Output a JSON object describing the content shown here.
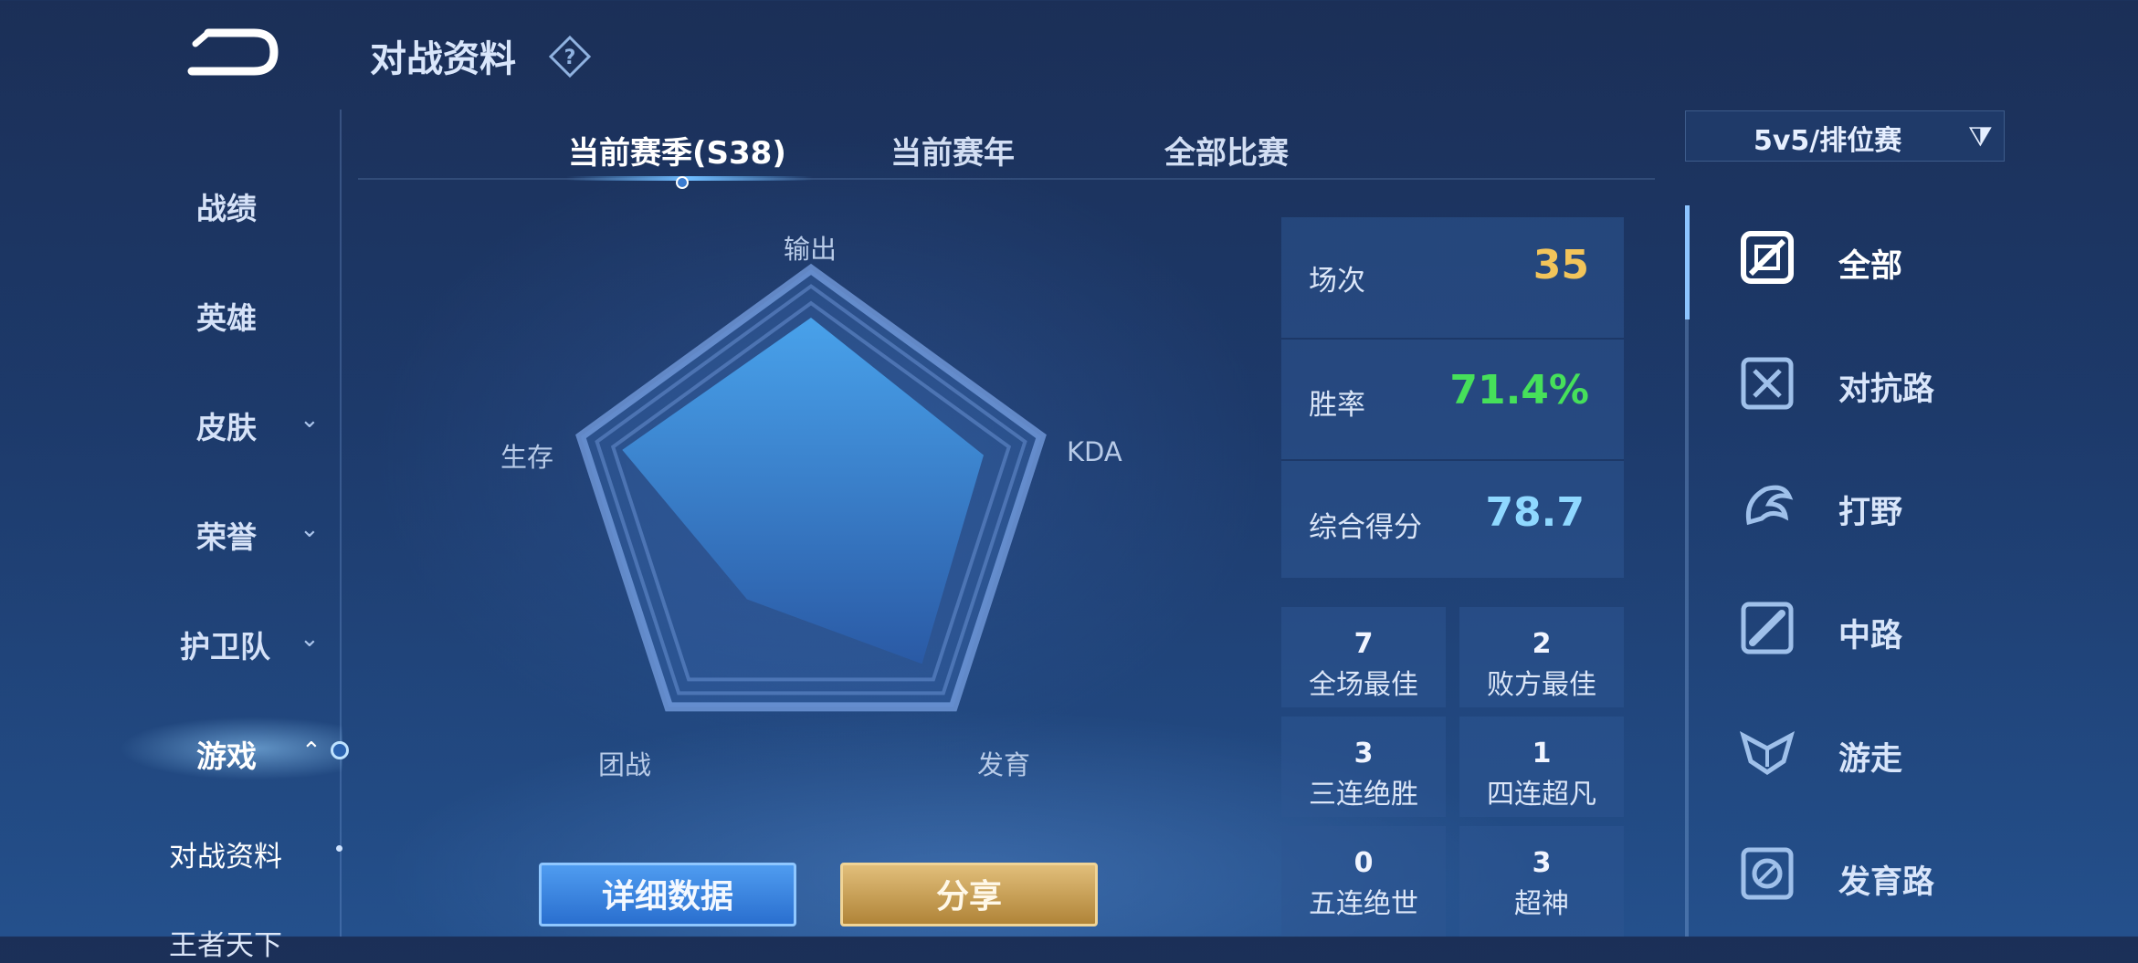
{
  "header": {
    "title": "对战资料",
    "back_icon": "back-arrow-icon",
    "help_icon": "question-diamond-icon"
  },
  "sidebar": {
    "items": [
      {
        "label": "战绩",
        "expandable": false
      },
      {
        "label": "英雄",
        "expandable": false
      },
      {
        "label": "皮肤",
        "expandable": true
      },
      {
        "label": "荣誉",
        "expandable": true
      },
      {
        "label": "护卫队",
        "expandable": true
      },
      {
        "label": "游戏",
        "expandable": true,
        "active": true
      }
    ],
    "subitems": [
      {
        "label": "对战资料",
        "active": true
      },
      {
        "label": "王者天下"
      }
    ]
  },
  "tabs": [
    {
      "label": "当前赛季(S38)",
      "active": true
    },
    {
      "label": "当前赛年"
    },
    {
      "label": "全部比赛"
    }
  ],
  "filter": {
    "label": "5v5/排位赛",
    "icon": "filter-icon"
  },
  "radar": {
    "axes": [
      "输出",
      "KDA",
      "发育",
      "团战",
      "生存"
    ],
    "values": [
      0.8,
      0.75,
      0.78,
      0.45,
      0.82
    ],
    "max": 1
  },
  "stats": {
    "games": {
      "label": "场次",
      "value": "35",
      "color": "#f2c45a"
    },
    "winrate": {
      "label": "胜率",
      "value": "71.4%",
      "color": "#46e05a"
    },
    "score": {
      "label": "综合得分",
      "value": "78.7",
      "color": "#8fd8ff"
    }
  },
  "achievements": [
    {
      "count": "7",
      "label": "全场最佳"
    },
    {
      "count": "2",
      "label": "败方最佳"
    },
    {
      "count": "3",
      "label": "三连绝胜"
    },
    {
      "count": "1",
      "label": "四连超凡"
    },
    {
      "count": "0",
      "label": "五连绝世"
    },
    {
      "count": "3",
      "label": "超神"
    }
  ],
  "buttons": {
    "detail": "详细数据",
    "share": "分享"
  },
  "roles": [
    {
      "label": "全部",
      "icon": "all-roles-icon",
      "active": true
    },
    {
      "label": "对抗路",
      "icon": "clash-lane-icon"
    },
    {
      "label": "打野",
      "icon": "jungle-icon"
    },
    {
      "label": "中路",
      "icon": "mid-lane-icon"
    },
    {
      "label": "游走",
      "icon": "roam-icon"
    },
    {
      "label": "发育路",
      "icon": "farm-lane-icon"
    }
  ]
}
